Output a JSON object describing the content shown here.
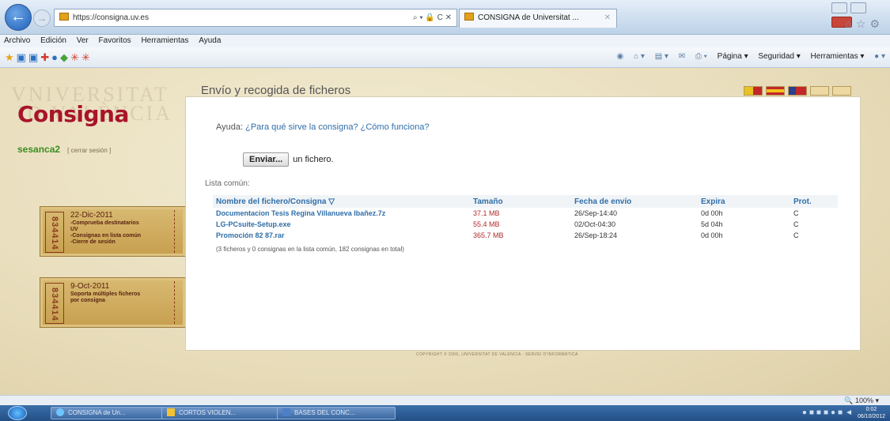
{
  "browser": {
    "url": "https://consigna.uv.es",
    "address_tools": "⌕ ▾ 🔒 C ✕",
    "tab_title": "CONSIGNA de Universitat ...",
    "menu": [
      "Archivo",
      "Edición",
      "Ver",
      "Favoritos",
      "Herramientas",
      "Ayuda"
    ],
    "command_bar": {
      "page": "Página ▾",
      "security": "Seguridad ▾",
      "tools": "Herramientas ▾"
    },
    "zoom": "🔍 100%  ▾"
  },
  "site": {
    "watermark_line1": "VNIVERSITAT",
    "watermark_line2": "ID VALÈNCIA",
    "logo": "Consigna",
    "username": "sesanca2",
    "logout": "[ cerrar sesión ]",
    "heading": "Envío y recogida de ficheros",
    "help_prefix": "Ayuda: ",
    "help_link_1": "¿Para qué sirve la consigna?",
    "help_link_2": "¿Cómo funciona?",
    "send_button": "Enviar...",
    "send_suffix": "un fichero.",
    "list_heading": "Lista común:",
    "summary": "(3 ficheros y 0 consignas en la lista común, 182 consignas en total)",
    "copyright": "COPYRIGHT © 2006, UNIVERSITAT DE VALÈNCIA - SERVEI D'INFORMÀTICA"
  },
  "tickets": [
    {
      "serial": "834414",
      "date": "22-Dic-2011",
      "notes": [
        "-Comprueba destinatarios",
        " UV",
        "-Consignas en lista común",
        "-Cierre de sesión"
      ]
    },
    {
      "serial": "834414",
      "date": "9-Oct-2011",
      "notes": [
        "Soporta múltiples ficheros",
        "por consigna"
      ]
    }
  ],
  "table": {
    "headers": [
      "Nombre del fichero/Consigna ▽",
      "Tamaño",
      "Fecha de envío",
      "Expira",
      "Prot."
    ],
    "rows": [
      [
        "Documentacion Tesis Regina Villanueva Ibañez.7z",
        "37.1 MB",
        "26/Sep-14:40",
        "0d 00h",
        "C"
      ],
      [
        "LG-PCsuite-Setup.exe",
        "55.4 MB",
        "02/Oct-04:30",
        "5d 04h",
        "C"
      ],
      [
        "Promoción 82 87.rar",
        "365.7 MB",
        "26/Sep-18:24",
        "0d 00h",
        "C"
      ]
    ]
  },
  "taskbar": {
    "tasks": [
      "CONSIGNA de Un...",
      "CORTOS VIOLEN...",
      "BASES DEL CONC..."
    ],
    "clock_time": "0:02",
    "clock_date": "06/10/2012"
  }
}
